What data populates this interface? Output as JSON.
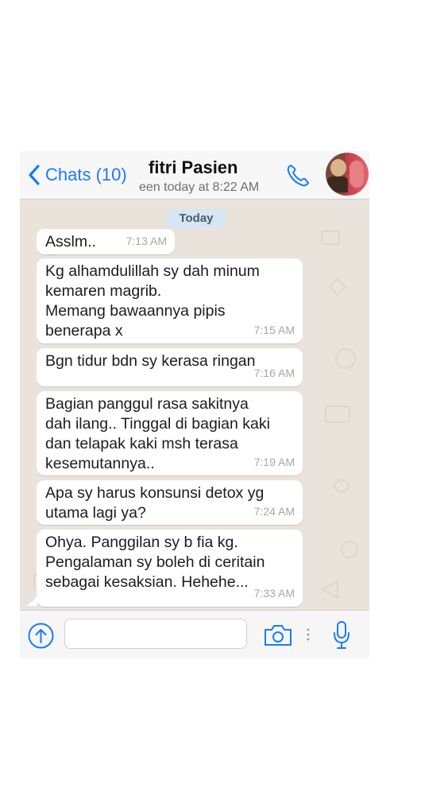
{
  "header": {
    "back_label": "Chats (10)",
    "contact_name": "fitri Pasien",
    "status": "een today at 8:22 AM"
  },
  "icons": {
    "back": "chevron-left-icon",
    "call": "phone-icon",
    "avatar": "contact-avatar",
    "attach": "upload-arrow-icon",
    "camera": "camera-icon",
    "more": "vertical-dots-icon",
    "mic": "microphone-icon"
  },
  "colors": {
    "accent": "#1a7cf5",
    "chat_background": "#e9e3dc",
    "bubble": "#ffffff",
    "date_pill": "#d6e6f4"
  },
  "chat": {
    "date_label": "Today",
    "messages": [
      {
        "text": "Asslm..",
        "time": "7:13 AM"
      },
      {
        "text": "Kg alhamdulillah sy dah minum\nkemaren magrib.\nMemang bawaannya pipis\nbenerapa x",
        "time": "7:15 AM"
      },
      {
        "text": "Bgn tidur bdn sy kerasa ringan",
        "time": "7:16 AM"
      },
      {
        "text": "Bagian panggul rasa sakitnya\ndah ilang.. Tinggal di bagian kaki\ndan telapak kaki msh terasa\nkesemutannya..",
        "time": "7:19 AM"
      },
      {
        "text": "Apa sy harus konsunsi detox yg\nutama lagi ya?",
        "time": "7:24 AM"
      },
      {
        "text": "Ohya. Panggilan sy b fia kg.\nPengalaman sy boleh di ceritain\nsebagai kesaksian. Hehehe...",
        "time": "7:33 AM"
      }
    ]
  },
  "composer": {
    "input_value": "",
    "input_placeholder": ""
  }
}
